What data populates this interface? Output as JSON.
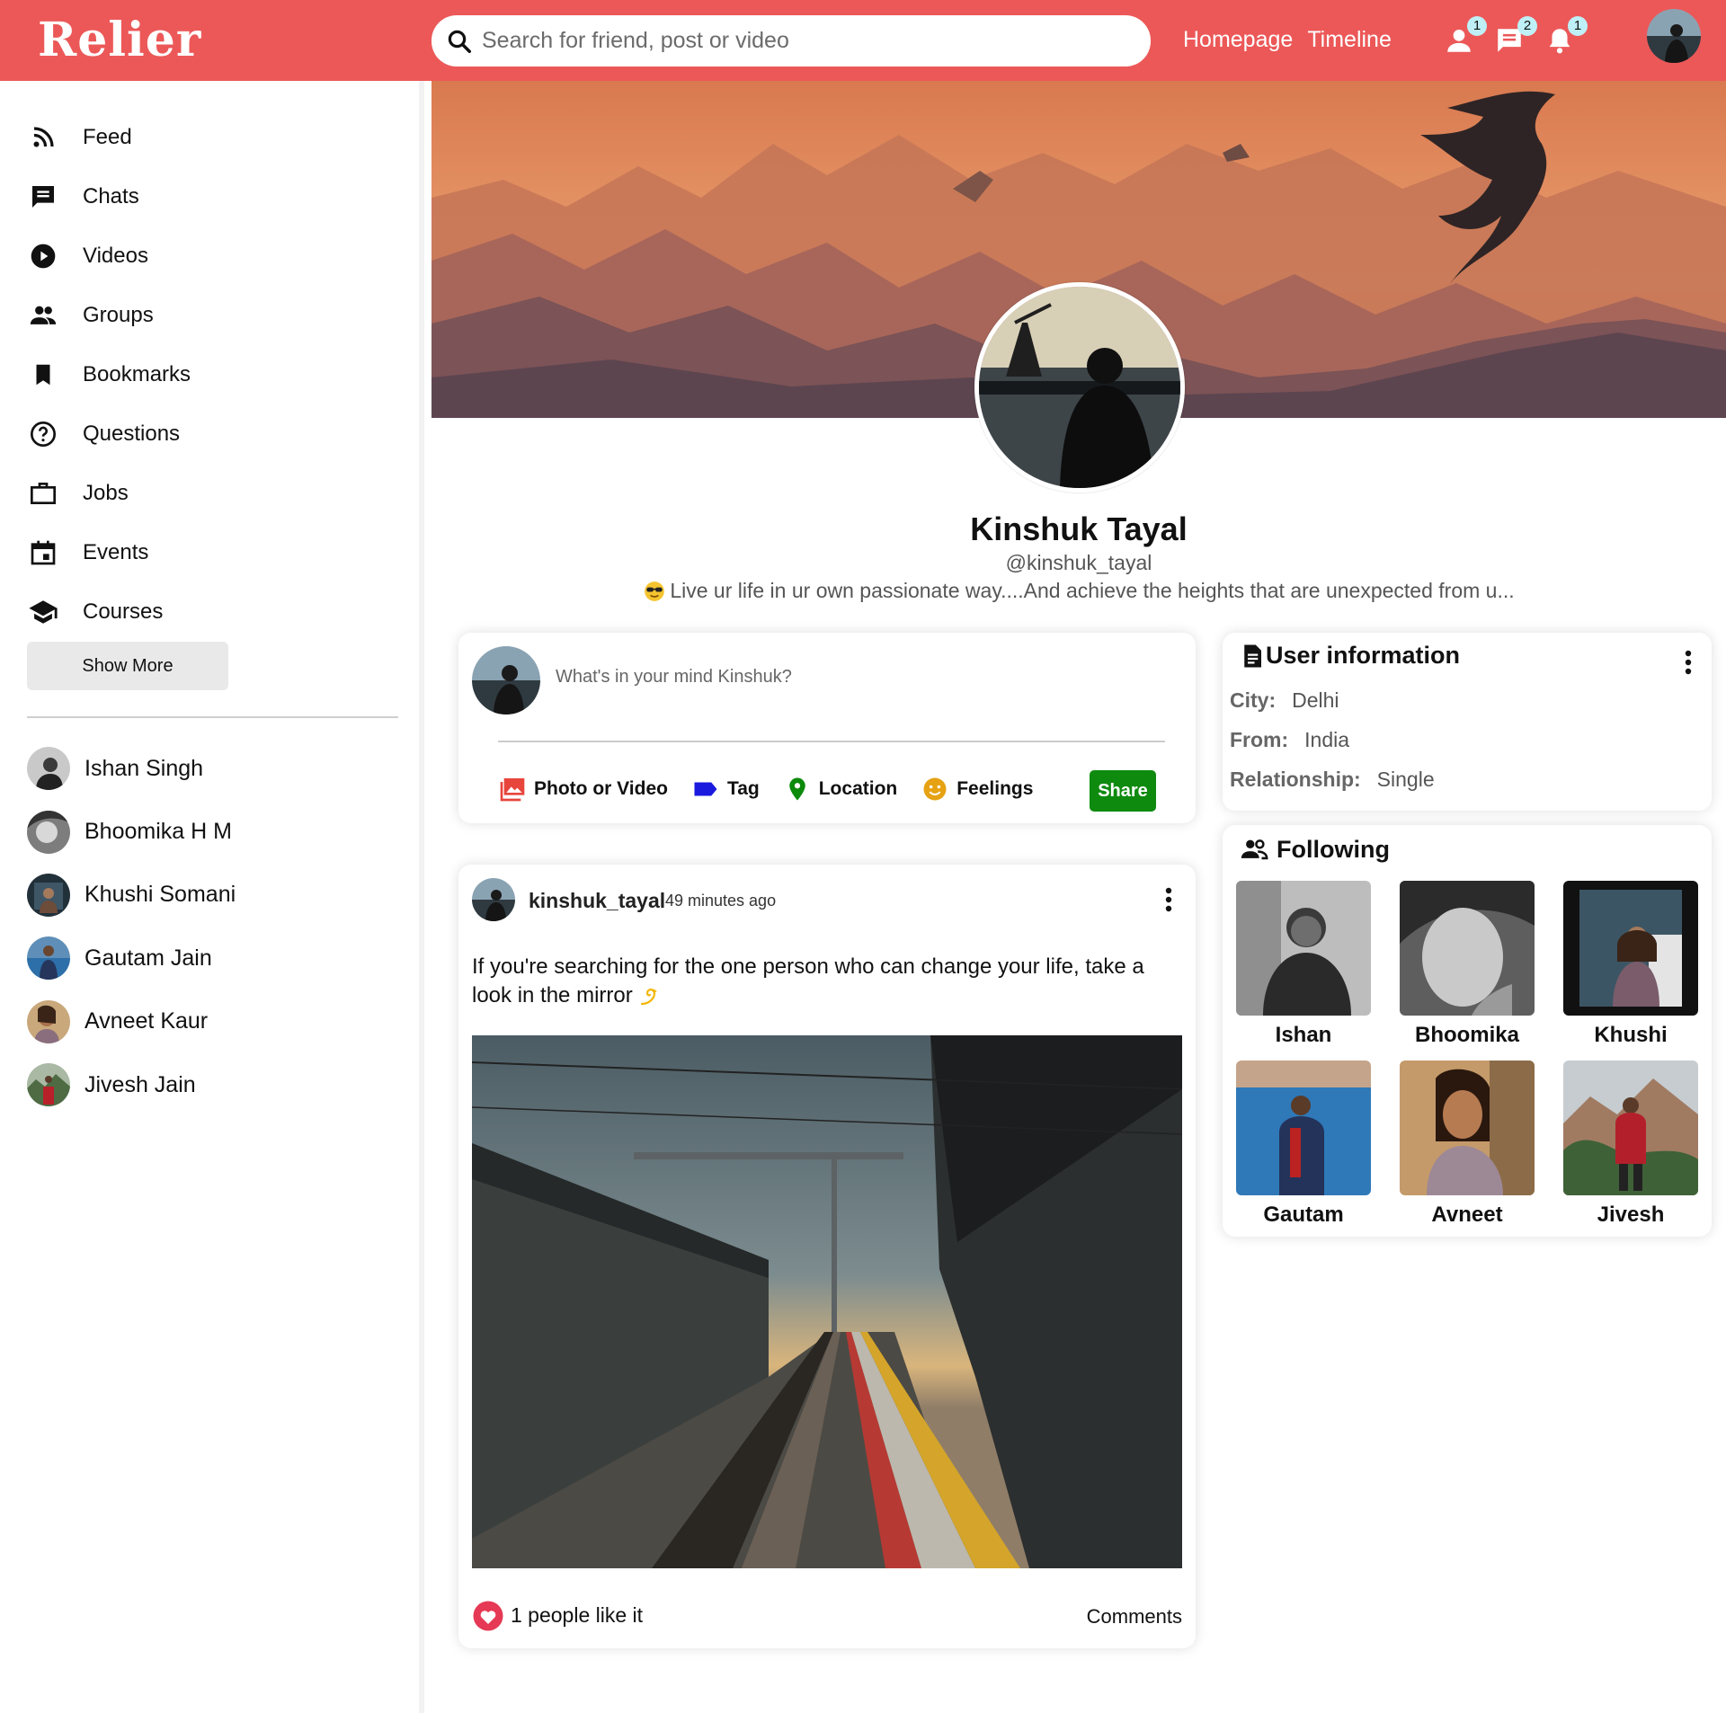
{
  "brand": {
    "logo": "Relier",
    "accent": "#ec5858"
  },
  "search": {
    "placeholder": "Search for friend, post or video"
  },
  "topnav": {
    "links": [
      "Homepage",
      "Timeline"
    ],
    "badges": {
      "friend_requests": "1",
      "messages": "2",
      "notifications": "1"
    }
  },
  "sidebar": {
    "items": [
      {
        "label": "Feed",
        "icon": "rss-feed-icon"
      },
      {
        "label": "Chats",
        "icon": "chat-icon"
      },
      {
        "label": "Videos",
        "icon": "play-circle-icon"
      },
      {
        "label": "Groups",
        "icon": "group-icon"
      },
      {
        "label": "Bookmarks",
        "icon": "bookmark-icon"
      },
      {
        "label": "Questions",
        "icon": "help-outline-icon"
      },
      {
        "label": "Jobs",
        "icon": "work-outline-icon"
      },
      {
        "label": "Events",
        "icon": "event-icon"
      },
      {
        "label": "Courses",
        "icon": "school-icon"
      }
    ],
    "show_more": "Show More",
    "friends": [
      "Ishan Singh",
      "Bhoomika H M",
      "Khushi Somani",
      "Gautam Jain",
      "Avneet Kaur",
      "Jivesh Jain"
    ]
  },
  "profile": {
    "name": "Kinshuk Tayal",
    "handle": "@kinshuk_tayal",
    "bio": "Live ur life in ur own passionate way....And achieve the heights that are unexpected from u..."
  },
  "share": {
    "placeholder": "What's in your mind Kinshuk?",
    "options": [
      "Photo or Video",
      "Tag",
      "Location",
      "Feelings"
    ],
    "button": "Share",
    "colors": {
      "photo": "#e8453c",
      "tag": "#1a1adf",
      "location": "#0b8a0b",
      "feelings": "#e6a213"
    }
  },
  "post": {
    "username": "kinshuk_tayal",
    "time": "49 minutes ago",
    "text": "If you're searching for the one person who can change your life, take a look in the mirror",
    "likes": "1 people like it",
    "comments": "Comments"
  },
  "user_info": {
    "title": "User information",
    "rows": [
      {
        "label": "City:",
        "value": "Delhi"
      },
      {
        "label": "From:",
        "value": "India"
      },
      {
        "label": "Relationship:",
        "value": "Single"
      }
    ]
  },
  "following": {
    "title": "Following",
    "people": [
      "Ishan",
      "Bhoomika",
      "Khushi",
      "Gautam",
      "Avneet",
      "Jivesh"
    ]
  }
}
